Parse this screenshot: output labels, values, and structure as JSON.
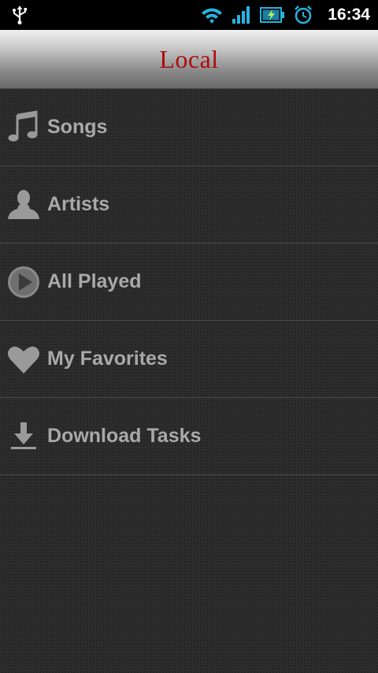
{
  "status_bar": {
    "time": "16:34"
  },
  "header": {
    "title": "Local"
  },
  "menu": [
    {
      "label": "Songs",
      "icon": "music-note-icon"
    },
    {
      "label": "Artists",
      "icon": "person-icon"
    },
    {
      "label": "All Played",
      "icon": "play-circle-icon"
    },
    {
      "label": "My Favorites",
      "icon": "heart-icon"
    },
    {
      "label": "Download Tasks",
      "icon": "download-icon"
    }
  ],
  "colors": {
    "title": "#b00b0b",
    "label": "#a9a9a9",
    "status_accent": "#27b3e0"
  }
}
